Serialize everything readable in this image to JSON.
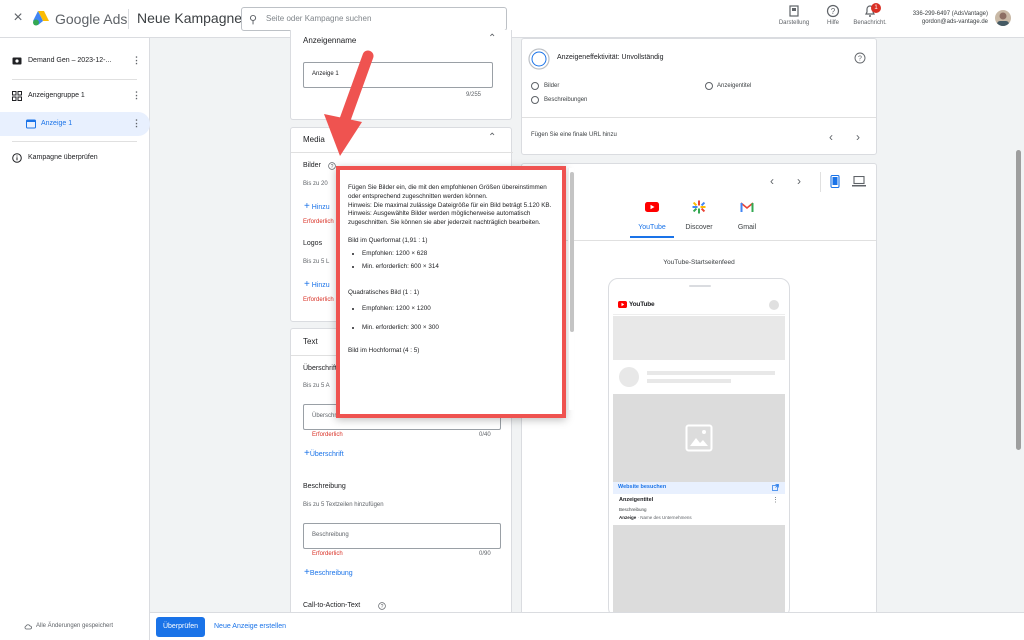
{
  "header": {
    "close": "×",
    "brand": "Google Ads",
    "page_title": "Neue Kampagne",
    "search_placeholder": "Seite oder Kampagne suchen",
    "buttons": [
      {
        "label": "Darstellung"
      },
      {
        "label": "Hilfe"
      },
      {
        "label": "Benachricht.",
        "badge": "1"
      }
    ],
    "account_id": "336-299-6497 (AdsVantage)",
    "account_email": "gordon@ads-vantage.de"
  },
  "sidebar": {
    "items": [
      {
        "label": "Demand Gen – 2023-12-..."
      },
      {
        "label": "Anzeigengruppe 1"
      },
      {
        "label": "Anzeige 1"
      },
      {
        "label": "Kampagne überprüfen"
      }
    ],
    "saved_status": "Alle Änderungen gespeichert"
  },
  "footer": {
    "review_button": "Überprüfen",
    "new_ad_link": "Neue Anzeige erstellen"
  },
  "form": {
    "ad_name": {
      "title": "Anzeigenname",
      "value": "Anzeige 1",
      "counter": "9/255"
    },
    "media": {
      "title": "Media",
      "images_label": "Bilder",
      "images_hint": "Bis zu 20",
      "images_add": "Hinzu",
      "images_required": "Erforderlich",
      "logos_label": "Logos",
      "logos_hint": "Bis zu 5 L",
      "logos_add": "Hinzu",
      "logos_required": "Erforderlich"
    },
    "text": {
      "title": "Text",
      "headline_label": "Überschrift",
      "headline_hint": "Bis zu 5 A",
      "headline_placeholder": "Überschrift",
      "headline_required": "Erforderlich",
      "headline_counter": "0/40",
      "headline_add": "Überschrift",
      "description_label": "Beschreibung",
      "description_hint": "Bis zu 5 Textzeilen hinzufügen",
      "description_placeholder": "Beschreibung",
      "description_required": "Erforderlich",
      "description_counter": "0/90",
      "description_add": "Beschreibung",
      "cta_label": "Call-to-Action-Text"
    }
  },
  "effectiveness": {
    "title": "Anzeigeneffektivität: Unvollständig",
    "items": [
      "Bilder",
      "Anzeigentitel",
      "Beschreibungen"
    ],
    "hint": "Fügen Sie eine finale URL hinzu"
  },
  "preview": {
    "tabs": [
      "YouTube",
      "Discover",
      "Gmail"
    ],
    "active_tab": "YouTube",
    "feed_label": "YouTube-Startseitenfeed",
    "yt_logo": "YouTube",
    "visit_site": "Website besuchen",
    "ad_title": "Anzeigentitel",
    "ad_desc": "Beschreibung",
    "ad_badge": "Anzeige",
    "ad_business": "Name des Unternehmens"
  },
  "tooltip": {
    "intro": "Fügen Sie Bilder ein, die mit den empfohlenen Größen übereinstimmen oder entsprechend zugeschnitten werden können.",
    "hint1": "Hinweis: Die maximal zulässige Dateigröße für ein Bild beträgt 5.120 KB.",
    "hint2": "Hinweis: Ausgewählte Bilder werden möglicherweise automatisch zugeschnitten. Sie können sie aber jederzeit nachträglich bearbeiten.",
    "landscape_title": "Bild im Querformat (1,91 : 1)",
    "landscape_rec": "Empfohlen: 1200 × 628",
    "landscape_min": "Min. erforderlich: 600 × 314",
    "square_title": "Quadratisches Bild (1 : 1)",
    "square_rec": "Empfohlen: 1200 × 1200",
    "square_min": "Min. erforderlich: 300 × 300",
    "portrait_title": "Bild im Hochformat (4 : 5)"
  },
  "colors": {
    "accent": "#1a73e8",
    "error": "#d93025",
    "annotation": "#ef5350"
  }
}
